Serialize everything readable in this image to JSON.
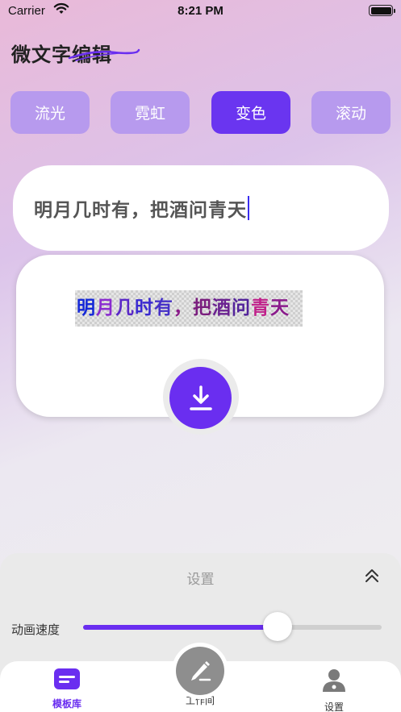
{
  "status_bar": {
    "carrier": "Carrier",
    "time": "8:21 PM",
    "battery_level": 1.0
  },
  "page_title": "微文字编辑",
  "effect_tabs": [
    {
      "label": "流光",
      "active": false
    },
    {
      "label": "霓虹",
      "active": false
    },
    {
      "label": "变色",
      "active": true
    },
    {
      "label": "滚动",
      "active": false
    }
  ],
  "text_input": {
    "value": "明月几时有，把酒问青天"
  },
  "preview": {
    "chars": [
      {
        "c": "明",
        "color": "#1428d8"
      },
      {
        "c": "月",
        "color": "#8a2bd0"
      },
      {
        "c": "几",
        "color": "#5a28c8"
      },
      {
        "c": "时",
        "color": "#3a2ad0"
      },
      {
        "c": "有",
        "color": "#4631c8"
      },
      {
        "c": "，",
        "color": "#8b1a8a"
      },
      {
        "c": "把",
        "color": "#7a1e7e"
      },
      {
        "c": "酒",
        "color": "#6a2190"
      },
      {
        "c": "问",
        "color": "#52229a"
      },
      {
        "c": "青",
        "color": "#c0208a"
      },
      {
        "c": "天",
        "color": "#8b1c8c"
      }
    ]
  },
  "settings": {
    "title": "设置",
    "speed_label": "动画速度",
    "speed_value": 0.65
  },
  "tab_bar": {
    "items": [
      {
        "label": "模板库",
        "icon": "template-library-icon",
        "active": true
      },
      {
        "label": "工作间",
        "icon": "edit-pen-icon",
        "active": false
      },
      {
        "label": "设置",
        "icon": "user-settings-icon",
        "active": false
      }
    ]
  },
  "colors": {
    "accent": "#6a2ef0",
    "tab_inactive": "#b79aee"
  }
}
